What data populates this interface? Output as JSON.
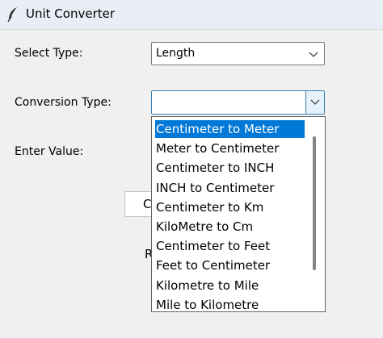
{
  "window": {
    "title": "Unit Converter",
    "icon": "feather-icon"
  },
  "form": {
    "select_type_label": "Select Type:",
    "select_type_value": "Length",
    "conversion_type_label": "Conversion Type:",
    "conversion_type_value": "",
    "enter_value_label": "Enter Value:"
  },
  "obscured": {
    "button_fragment": "C",
    "result_fragment": "R"
  },
  "dropdown": {
    "selected_index": 0,
    "selected_color": "#0078d7",
    "items": [
      "Centimeter to Meter",
      "Meter to Centimeter",
      "Centimeter to INCH",
      "INCH to Centimeter",
      "Centimeter to Km",
      "KiloMetre to Cm",
      "Centimeter to Feet",
      "Feet to Centimeter",
      "Kilometre to Mile",
      "Mile to Kilometre"
    ]
  }
}
